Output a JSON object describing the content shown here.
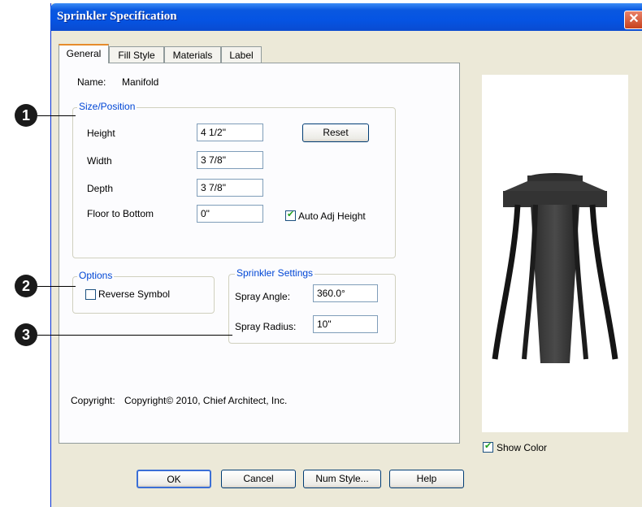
{
  "window": {
    "title": "Sprinkler Specification",
    "close_symbol": "✕"
  },
  "tabs": [
    {
      "label": "General",
      "active": true
    },
    {
      "label": "Fill Style",
      "active": false
    },
    {
      "label": "Materials",
      "active": false
    },
    {
      "label": "Label",
      "active": false
    }
  ],
  "general": {
    "name_label": "Name:",
    "name_value": "Manifold",
    "size_position": {
      "legend": "Size/Position",
      "height_label": "Height",
      "height_value": "4 1/2\"",
      "width_label": "Width",
      "width_value": "3 7/8\"",
      "depth_label": "Depth",
      "depth_value": "3 7/8\"",
      "floor_label": "Floor to Bottom",
      "floor_value": "0\"",
      "reset_label": "Reset",
      "auto_adj_label": "Auto Adj Height",
      "auto_adj_checked": true
    },
    "options": {
      "legend": "Options",
      "reverse_label": "Reverse Symbol",
      "reverse_checked": false
    },
    "sprinkler_settings": {
      "legend": "Sprinkler Settings",
      "spray_angle_label": "Spray Angle:",
      "spray_angle_value": "360.0°",
      "spray_radius_label": "Spray Radius:",
      "spray_radius_value": "10\""
    },
    "copyright_label": "Copyright:",
    "copyright_value": "Copyright© 2010, Chief Architect, Inc."
  },
  "preview": {
    "show_color_label": "Show Color",
    "show_color_checked": true
  },
  "buttons": {
    "ok": "OK",
    "cancel": "Cancel",
    "num_style": "Num Style...",
    "help": "Help"
  },
  "callouts": [
    "1",
    "2",
    "3"
  ]
}
